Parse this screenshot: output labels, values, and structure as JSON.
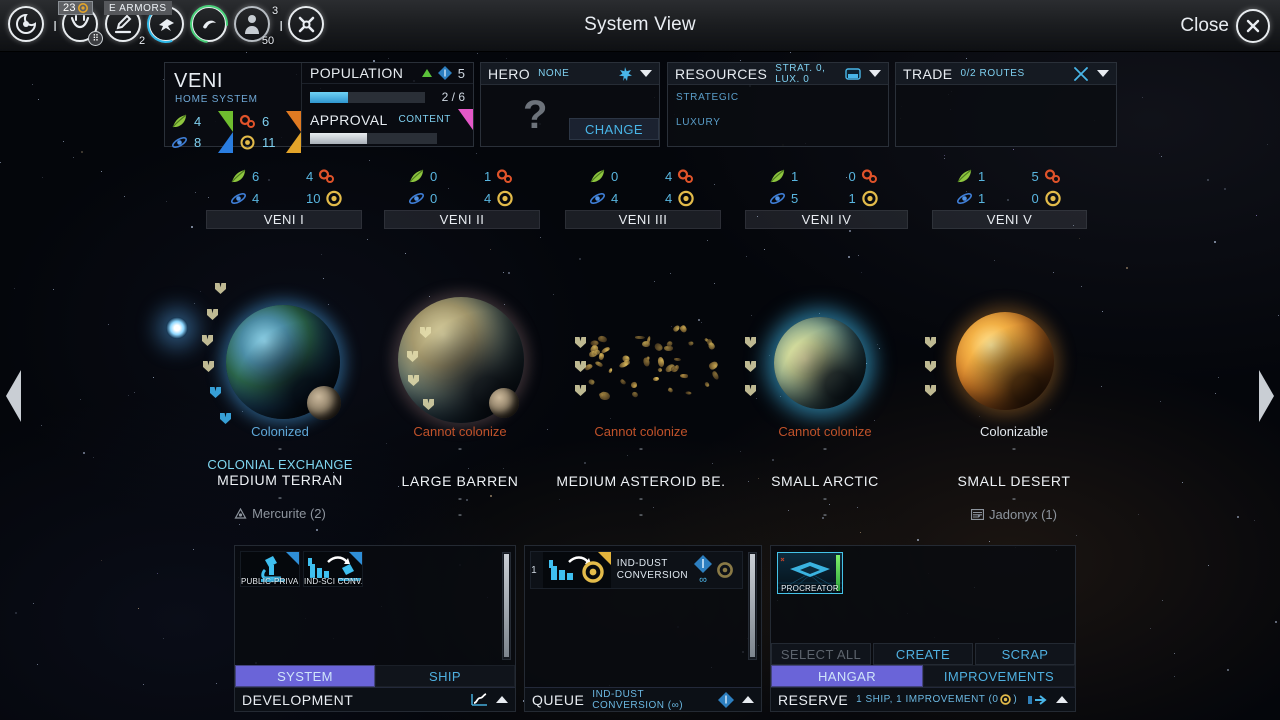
{
  "topbar": {
    "title": "System View",
    "close_label": "Close",
    "close_icon": "close-circle-icon",
    "empire_icons": [
      {
        "name": "empire-emblem-icon",
        "badge": null,
        "num": null
      },
      {
        "name": "diplomacy-icon",
        "badge": "grid",
        "num": null
      },
      {
        "name": "research-icon",
        "badge": null,
        "num": "2"
      },
      {
        "name": "fleet-icon",
        "badge": null,
        "num": null
      },
      {
        "name": "trade-icon",
        "badge": null,
        "num": null
      },
      {
        "name": "population-icon",
        "badge": null,
        "num": "50",
        "num_top": "3"
      },
      {
        "name": "options-icon",
        "badge": null,
        "num": null
      }
    ],
    "dust_amount": "23",
    "armor_label": "E ARMORS"
  },
  "system": {
    "name": "VENI",
    "subtitle": "HOME SYSTEM",
    "fidsi": [
      {
        "icon": "food-icon",
        "value": "4"
      },
      {
        "icon": "industry-icon",
        "value": "6"
      },
      {
        "icon": "science-icon",
        "value": "8"
      },
      {
        "icon": "dust-icon",
        "value": "11"
      }
    ],
    "population": {
      "label": "POPULATION",
      "trend_icon": "trend-up-icon",
      "pop_icon": "pop-diamond-icon",
      "value": "5",
      "ratio": "2 / 6",
      "bar_percent": 33
    },
    "approval": {
      "label": "APPROVAL",
      "status": "CONTENT",
      "bar_percent": 45
    }
  },
  "hero": {
    "label": "HERO",
    "value": "NONE",
    "icon": "hero-star-icon",
    "caret_icon": "chevron-down-icon",
    "placeholder_glyph": "?",
    "change_label": "CHANGE"
  },
  "resources": {
    "label": "RESOURCES",
    "summary": "STRAT. 0, LUX. 0",
    "icon": "resource-icon",
    "caret_icon": "chevron-down-icon",
    "rows": [
      "STRATEGIC",
      "LUXURY"
    ]
  },
  "trade": {
    "label": "TRADE",
    "summary": "0/2 ROUTES",
    "icon": "trade-routes-icon",
    "caret_icon": "chevron-down-icon"
  },
  "planet_stats": [
    {
      "name": "VENI I",
      "food": "6",
      "science": "4",
      "industry": "4",
      "dust": "10"
    },
    {
      "name": "VENI II",
      "food": "0",
      "science": "0",
      "industry": "1",
      "dust": "4"
    },
    {
      "name": "VENI III",
      "food": "0",
      "science": "4",
      "industry": "4",
      "dust": "4"
    },
    {
      "name": "VENI IV",
      "food": "1",
      "science": "5",
      "industry": "0",
      "dust": "1"
    },
    {
      "name": "VENI V",
      "food": "1",
      "science": "1",
      "industry": "5",
      "dust": "0"
    }
  ],
  "planets": [
    {
      "state": "Colonized",
      "state_color": "#5fa8d8",
      "anomaly": "COLONIAL EXCHANGE",
      "type": "MEDIUM TERRAN",
      "resource": "Mercurite (2)",
      "resource_icon": "strategic-resource-icon",
      "dash_top": "-",
      "dash_mid": "-",
      "dash_bottom": "-",
      "pop_slots_filled": 2,
      "pop_slots_total": 6
    },
    {
      "state": "Cannot colonize",
      "state_color": "#c0522a",
      "anomaly": "-",
      "type": "LARGE BARREN",
      "resource": "-",
      "dash_top": "-",
      "dash_mid": "-",
      "dash_bottom": "-",
      "pop_slots_filled": 0,
      "pop_slots_total": 4
    },
    {
      "state": "Cannot colonize",
      "state_color": "#c0522a",
      "anomaly": "-",
      "type": "MEDIUM ASTEROID BE.",
      "resource": "-",
      "dash_top": "-",
      "dash_mid": "-",
      "dash_bottom": "-",
      "pop_slots_filled": 0,
      "pop_slots_total": 3
    },
    {
      "state": "Cannot colonize",
      "state_color": "#c0522a",
      "anomaly": "-",
      "type": "SMALL ARCTIC",
      "resource": "-",
      "dash_top": "-",
      "dash_mid": "-",
      "dash_bottom": "-",
      "pop_slots_filled": 0,
      "pop_slots_total": 3
    },
    {
      "state": "Colonizable",
      "state_color": "#e4e9ee",
      "anomaly": "-",
      "type": "SMALL DESERT",
      "resource": "Jadonyx (1)",
      "resource_icon": "luxury-resource-icon",
      "dash_top": "-",
      "dash_mid": "-",
      "dash_bottom": "-",
      "pop_slots_filled": 0,
      "pop_slots_total": 3
    }
  ],
  "development": {
    "footer_title": "DEVELOPMENT",
    "footer_icon": "growth-chart-icon",
    "collapse_icon": "chevron-up-icon",
    "tabs": [
      {
        "label": "SYSTEM",
        "selected": true
      },
      {
        "label": "SHIP",
        "selected": false
      }
    ],
    "items": [
      {
        "label": "PUBLIC-PRIVA.",
        "icon": "microscope-icon"
      },
      {
        "label": "IND-SCI CONV.",
        "icon": "industry-science-conversion-icon"
      }
    ]
  },
  "queue": {
    "footer_title": "QUEUE",
    "footer_sub": "IND-DUST CONVERSION (∞)",
    "footer_icon": "pop-diamond-icon",
    "collapse_icon": "chevron-up-icon",
    "items": [
      {
        "index": "1",
        "name_line1": "IND-DUST",
        "name_line2": "CONVERSION",
        "icon": "industry-dust-conversion-icon",
        "turns": "∞",
        "cost_icon": "pop-diamond-icon",
        "dust_icon": "dust-icon"
      }
    ]
  },
  "reserve": {
    "footer_title": "RESERVE",
    "footer_sub": "1 SHIP, 1 IMPROVEMENT (0",
    "footer_sub_suffix": ")",
    "footer_dust_icon": "dust-icon",
    "deploy_icon": "deploy-arrow-icon",
    "collapse_icon": "chevron-up-icon",
    "actions": [
      {
        "label": "SELECT ALL",
        "enabled": false
      },
      {
        "label": "CREATE",
        "enabled": true
      },
      {
        "label": "SCRAP",
        "enabled": true
      }
    ],
    "tabs": [
      {
        "label": "HANGAR",
        "selected": true
      },
      {
        "label": "IMPROVEMENTS",
        "selected": false
      }
    ],
    "ships": [
      {
        "label": "PROCREATOR",
        "icon": "ship-icon",
        "health_percent": 100
      }
    ]
  },
  "nav": {
    "prev_icon": "arrow-left-icon",
    "next_icon": "arrow-right-icon"
  },
  "colors": {
    "accent_blue": "#4fb0e0",
    "purple_tab": "#6a64d8",
    "food_green": "#6fbe2f",
    "industry_orange": "#e07a22",
    "science_blue": "#2a7de0",
    "dust_yellow": "#e3a42a",
    "danger_red": "#c0522a"
  }
}
